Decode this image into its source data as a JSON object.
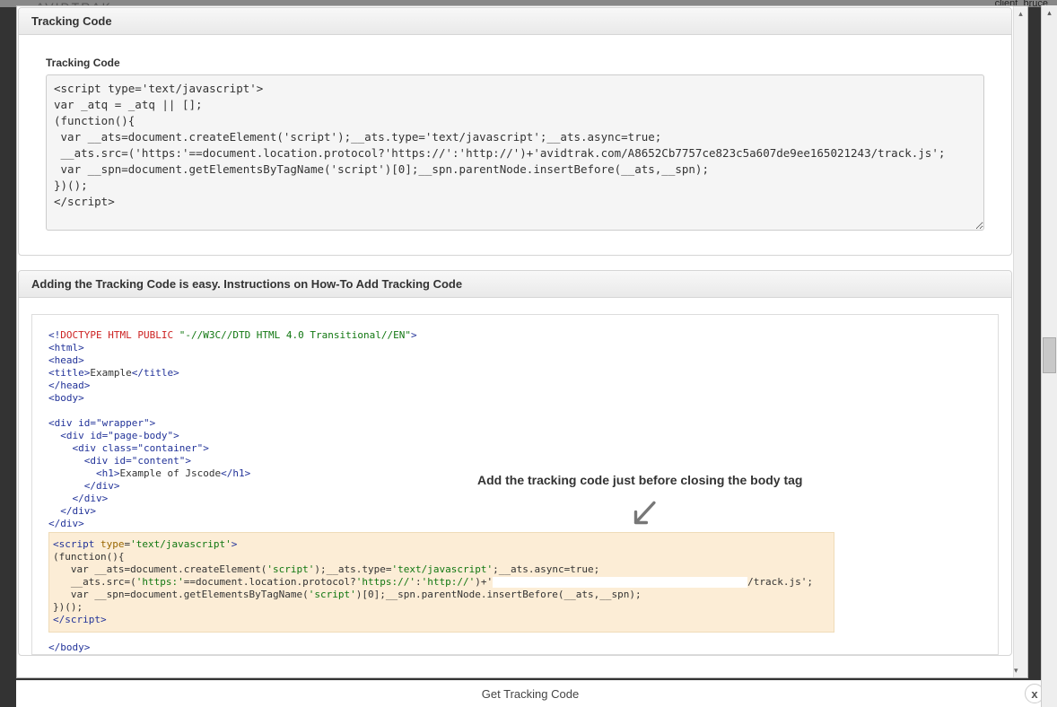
{
  "topbar": {
    "user_label": "client_bruce"
  },
  "logo": "AVIDTRAK",
  "modal": {
    "panel1": {
      "title": "Tracking Code",
      "subheader": "Tracking Code",
      "code": "<script type='text/javascript'>\nvar _atq = _atq || [];\n(function(){\n var __ats=document.createElement('script');__ats.type='text/javascript';__ats.async=true;\n __ats.src=('https:'==document.location.protocol?'https://':'http://')+'avidtrak.com/A8652Cb7757ce823c5a607de9ee165021243/track.js';\n var __spn=document.getElementsByTagName('script')[0];__spn.parentNode.insertBefore(__ats,__spn);\n})();\n</script>"
    },
    "panel2": {
      "title": "Adding the Tracking Code is easy. Instructions on How-To Add Tracking Code",
      "callout": "Add the tracking code just before closing the body tag",
      "example": {
        "doctype_pre": "<!",
        "doctype_words": "DOCTYPE HTML PUBLIC",
        "doctype_str": "\"-//W3C//DTD HTML 4.0 Transitional//EN\"",
        "html_open": "html",
        "head_open": "head",
        "title_open": "title",
        "title_text": "Example",
        "title_close": "/title",
        "head_close": "/head",
        "body_open": "body",
        "div_wrapper": "div id=\"wrapper\"",
        "div_pagebody": "div id=\"page-body\"",
        "div_container": "div class=\"container\"",
        "div_content": "div id=\"content\"",
        "h1_open": "h1",
        "h1_text": "Example of Jscode",
        "h1_close": "/h1",
        "div_close": "/div",
        "script_open": "script",
        "type_attr": "type",
        "type_val": "'text/javascript'",
        "func_line": "(function(){",
        "line1a": "   var __ats=document.createElement(",
        "str_script": "'script'",
        "line1b": ");__ats.type=",
        "line1c": ";__ats.async=true;",
        "line2a": "   __ats.src=(",
        "str_https": "'https:'",
        "line2b": "==document.location.protocol?",
        "str_httpsurl": "'https://'",
        "line2c": ":",
        "str_httpurl": "'http://'",
        "line2d": ")+'",
        "line2e": "/track.js';",
        "line3a": "   var __spn=document.getElementsByTagName(",
        "line3b": ")[0];__spn.parentNode.insertBefore(__ats,__spn);",
        "func_close": "})();",
        "script_close": "/script",
        "body_close": "/body"
      }
    },
    "footer": "Get Tracking Code",
    "close": "x"
  }
}
